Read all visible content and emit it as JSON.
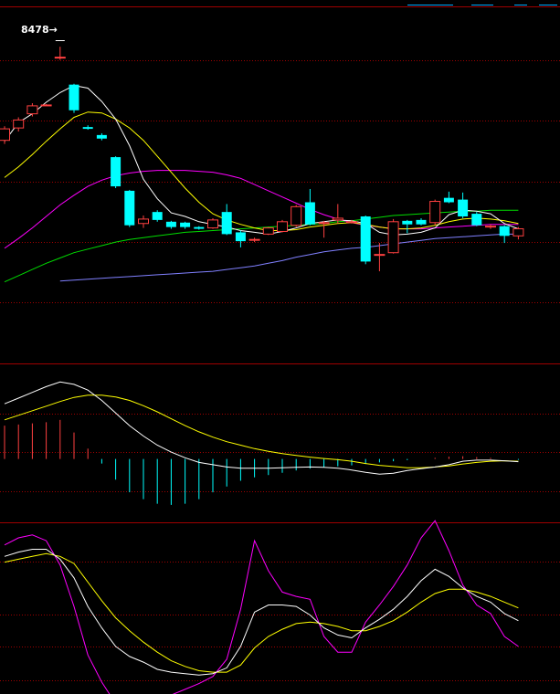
{
  "colors": {
    "background": "#000000",
    "grid": "#a00000",
    "up": "#ff4040",
    "down": "#00ffff",
    "ma5": "#ffffff",
    "ma10": "#ffff00",
    "ma20": "#ff00ff",
    "ma60": "#00dd00",
    "ma120": "#8080ff"
  },
  "price_label": "8478",
  "chart_data": [
    {
      "type": "candlestick",
      "panel": "price",
      "ylim": [
        5600,
        8800
      ],
      "candles": [
        {
          "o": 7420,
          "c": 7550,
          "h": 7580,
          "l": 7380
        },
        {
          "o": 7560,
          "c": 7650,
          "h": 7680,
          "l": 7520
        },
        {
          "o": 7720,
          "c": 7810,
          "h": 7840,
          "l": 7690
        },
        {
          "o": 7820,
          "c": 7820,
          "h": 7830,
          "l": 7810
        },
        {
          "o": 8360,
          "c": 8360,
          "h": 8478,
          "l": 8330
        },
        {
          "o": 8050,
          "c": 7760,
          "h": 8060,
          "l": 7730
        },
        {
          "o": 7570,
          "c": 7550,
          "h": 7590,
          "l": 7540
        },
        {
          "o": 7480,
          "c": 7440,
          "h": 7500,
          "l": 7420
        },
        {
          "o": 7230,
          "c": 6900,
          "h": 7240,
          "l": 6880
        },
        {
          "o": 6850,
          "c": 6460,
          "h": 6860,
          "l": 6440
        },
        {
          "o": 6480,
          "c": 6530,
          "h": 6570,
          "l": 6430
        },
        {
          "o": 6610,
          "c": 6520,
          "h": 6630,
          "l": 6500
        },
        {
          "o": 6500,
          "c": 6440,
          "h": 6510,
          "l": 6420
        },
        {
          "o": 6490,
          "c": 6440,
          "h": 6500,
          "l": 6420
        },
        {
          "o": 6440,
          "c": 6420,
          "h": 6450,
          "l": 6410
        },
        {
          "o": 6430,
          "c": 6520,
          "h": 6540,
          "l": 6420
        },
        {
          "o": 6610,
          "c": 6360,
          "h": 6700,
          "l": 6350
        },
        {
          "o": 6380,
          "c": 6280,
          "h": 6400,
          "l": 6210
        },
        {
          "o": 6300,
          "c": 6300,
          "h": 6320,
          "l": 6270
        },
        {
          "o": 6360,
          "c": 6430,
          "h": 6440,
          "l": 6350
        },
        {
          "o": 6390,
          "c": 6500,
          "h": 6520,
          "l": 6380
        },
        {
          "o": 6460,
          "c": 6670,
          "h": 6690,
          "l": 6440
        },
        {
          "o": 6720,
          "c": 6470,
          "h": 6870,
          "l": 6460
        },
        {
          "o": 6480,
          "c": 6490,
          "h": 6510,
          "l": 6320
        },
        {
          "o": 6520,
          "c": 6540,
          "h": 6700,
          "l": 6480
        },
        {
          "o": 6490,
          "c": 6500,
          "h": 6520,
          "l": 6480
        },
        {
          "o": 6560,
          "c": 6050,
          "h": 6570,
          "l": 6020
        },
        {
          "o": 6120,
          "c": 6130,
          "h": 6260,
          "l": 5940
        },
        {
          "o": 6150,
          "c": 6500,
          "h": 6530,
          "l": 6140
        },
        {
          "o": 6510,
          "c": 6470,
          "h": 6520,
          "l": 6370
        },
        {
          "o": 6520,
          "c": 6470,
          "h": 6540,
          "l": 6460
        },
        {
          "o": 6490,
          "c": 6730,
          "h": 6750,
          "l": 6460
        },
        {
          "o": 6770,
          "c": 6720,
          "h": 6840,
          "l": 6710
        },
        {
          "o": 6750,
          "c": 6560,
          "h": 6830,
          "l": 6540
        },
        {
          "o": 6590,
          "c": 6460,
          "h": 6610,
          "l": 6450
        },
        {
          "o": 6450,
          "c": 6450,
          "h": 6470,
          "l": 6420
        },
        {
          "o": 6450,
          "c": 6340,
          "h": 6460,
          "l": 6260
        },
        {
          "o": 6340,
          "c": 6420,
          "h": 6440,
          "l": 6300
        }
      ],
      "ma5": [
        7410,
        7620,
        7720,
        7850,
        7960,
        8040,
        8010,
        7860,
        7660,
        7360,
        6980,
        6760,
        6600,
        6560,
        6500,
        6470,
        6440,
        6400,
        6380,
        6360,
        6390,
        6430,
        6480,
        6500,
        6520,
        6510,
        6480,
        6380,
        6350,
        6360,
        6380,
        6430,
        6580,
        6630,
        6620,
        6590,
        6480,
        6420
      ],
      "ma10": [
        7000,
        7120,
        7260,
        7410,
        7550,
        7680,
        7740,
        7730,
        7660,
        7560,
        7420,
        7240,
        7060,
        6880,
        6720,
        6590,
        6520,
        6470,
        6430,
        6400,
        6400,
        6410,
        6440,
        6460,
        6480,
        6490,
        6470,
        6440,
        6420,
        6420,
        6430,
        6460,
        6500,
        6530,
        6540,
        6530,
        6510,
        6480
      ],
      "ma20": [
        6200,
        6310,
        6430,
        6560,
        6690,
        6800,
        6900,
        6970,
        7020,
        7050,
        7070,
        7080,
        7080,
        7080,
        7070,
        7060,
        7030,
        6990,
        6920,
        6850,
        6780,
        6710,
        6640,
        6580,
        6530,
        6490,
        6460,
        6440,
        6420,
        6420,
        6420,
        6430,
        6440,
        6450,
        6460,
        6470,
        6470,
        6470
      ],
      "ma60": [
        5820,
        5890,
        5960,
        6030,
        6090,
        6150,
        6190,
        6230,
        6270,
        6300,
        6320,
        6340,
        6360,
        6380,
        6390,
        6400,
        6410,
        6420,
        6430,
        6440,
        6450,
        6460,
        6470,
        6480,
        6500,
        6510,
        6530,
        6550,
        6570,
        6580,
        6590,
        6600,
        6610,
        6620,
        6620,
        6630,
        6630,
        6630
      ],
      "ma120": [
        null,
        null,
        null,
        null,
        5830,
        5840,
        5850,
        5860,
        5870,
        5880,
        5890,
        5900,
        5910,
        5920,
        5930,
        5940,
        5960,
        5980,
        6000,
        6030,
        6060,
        6100,
        6130,
        6160,
        6180,
        6200,
        6210,
        6230,
        6250,
        6270,
        6290,
        6310,
        6320,
        6330,
        6340,
        6350,
        6360,
        6360
      ]
    },
    {
      "type": "macd",
      "panel": "macd",
      "ylim": [
        -260,
        400
      ],
      "dif": [
        240,
        265,
        290,
        315,
        335,
        325,
        300,
        255,
        200,
        145,
        100,
        60,
        30,
        5,
        -15,
        -25,
        -35,
        -40,
        -40,
        -40,
        -38,
        -36,
        -35,
        -36,
        -40,
        -48,
        -58,
        -66,
        -62,
        -50,
        -42,
        -35,
        -25,
        -10,
        -5,
        -5,
        -8,
        -12
      ],
      "dea": [
        170,
        190,
        210,
        230,
        250,
        268,
        278,
        278,
        270,
        255,
        232,
        205,
        175,
        145,
        118,
        95,
        75,
        60,
        45,
        33,
        23,
        15,
        8,
        2,
        -3,
        -10,
        -20,
        -28,
        -33,
        -38,
        -38,
        -35,
        -30,
        -22,
        -15,
        -10,
        -8,
        -10
      ],
      "hist": [
        145,
        150,
        155,
        160,
        170,
        115,
        45,
        -20,
        -90,
        -145,
        -175,
        -195,
        -200,
        -195,
        -175,
        -145,
        -120,
        -95,
        -80,
        -70,
        -60,
        -50,
        -42,
        -36,
        -32,
        -28,
        -22,
        -15,
        -10,
        -5,
        0,
        5,
        10,
        12,
        8,
        5,
        0,
        -4
      ]
    },
    {
      "type": "kdj",
      "panel": "kdj",
      "ylim": [
        -5,
        110
      ],
      "k": [
        90,
        93,
        95,
        95,
        88,
        75,
        55,
        40,
        27,
        20,
        16,
        11,
        9,
        8,
        7,
        8,
        12,
        27,
        51,
        56,
        56,
        55,
        49,
        40,
        35,
        33,
        40,
        46,
        53,
        62,
        73,
        81,
        76,
        68,
        62,
        58,
        50,
        45
      ],
      "d": [
        86,
        88,
        90,
        92,
        90,
        85,
        72,
        59,
        47,
        38,
        30,
        23,
        17,
        13,
        10,
        9,
        9,
        14,
        26,
        34,
        39,
        43,
        44,
        43,
        41,
        38,
        38,
        41,
        45,
        51,
        58,
        64,
        67,
        67,
        65,
        62,
        58,
        54
      ],
      "j": [
        98,
        103,
        105,
        101,
        84,
        55,
        21,
        2,
        -13,
        -16,
        -12,
        -13,
        -7,
        -3,
        1,
        6,
        18,
        53,
        101,
        80,
        65,
        62,
        60,
        34,
        23,
        23,
        44,
        56,
        69,
        84,
        103,
        115,
        94,
        70,
        56,
        50,
        34,
        27
      ]
    }
  ]
}
